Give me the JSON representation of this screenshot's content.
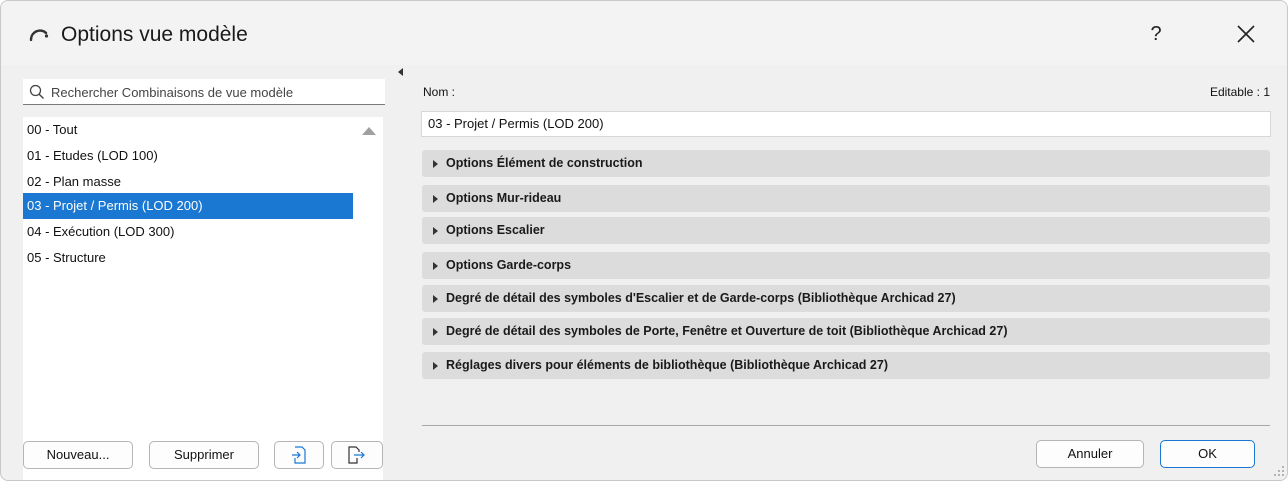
{
  "window": {
    "title": "Options vue modèle",
    "help_label": "?"
  },
  "left": {
    "search": {
      "placeholder": "Rechercher Combinaisons de vue modèle"
    },
    "items": [
      {
        "label": "00 - Tout"
      },
      {
        "label": "01 - Etudes (LOD 100)"
      },
      {
        "label": "02 - Plan masse"
      },
      {
        "label": "03 - Projet / Permis (LOD 200)"
      },
      {
        "label": "04 - Exécution (LOD 300)"
      },
      {
        "label": "05 - Structure"
      }
    ],
    "selected_index": 3,
    "new_button": "Nouveau...",
    "delete_button": "Supprimer",
    "import_icon": "import-icon",
    "export_icon": "export-icon"
  },
  "right": {
    "name_label": "Nom :",
    "editable_label": "Editable : 1",
    "name_value": "03 - Projet / Permis (LOD 200)",
    "sections": [
      {
        "label": "Options Élément de construction"
      },
      {
        "label": "Options Mur-rideau"
      },
      {
        "label": "Options Escalier"
      },
      {
        "label": "Options Garde-corps"
      },
      {
        "label": "Degré de détail des symboles d'Escalier et de Garde-corps (Bibliothèque Archicad 27)"
      },
      {
        "label": "Degré de détail des symboles de Porte, Fenêtre et Ouverture de toit (Bibliothèque Archicad 27)"
      },
      {
        "label": "Réglages divers pour éléments de bibliothèque (Bibliothèque Archicad 27)"
      }
    ],
    "cancel_button": "Annuler",
    "ok_button": "OK"
  },
  "colors": {
    "selection": "#1a78d2",
    "section_bg": "#dcdcdc",
    "window_bg": "#f0f0f0"
  }
}
